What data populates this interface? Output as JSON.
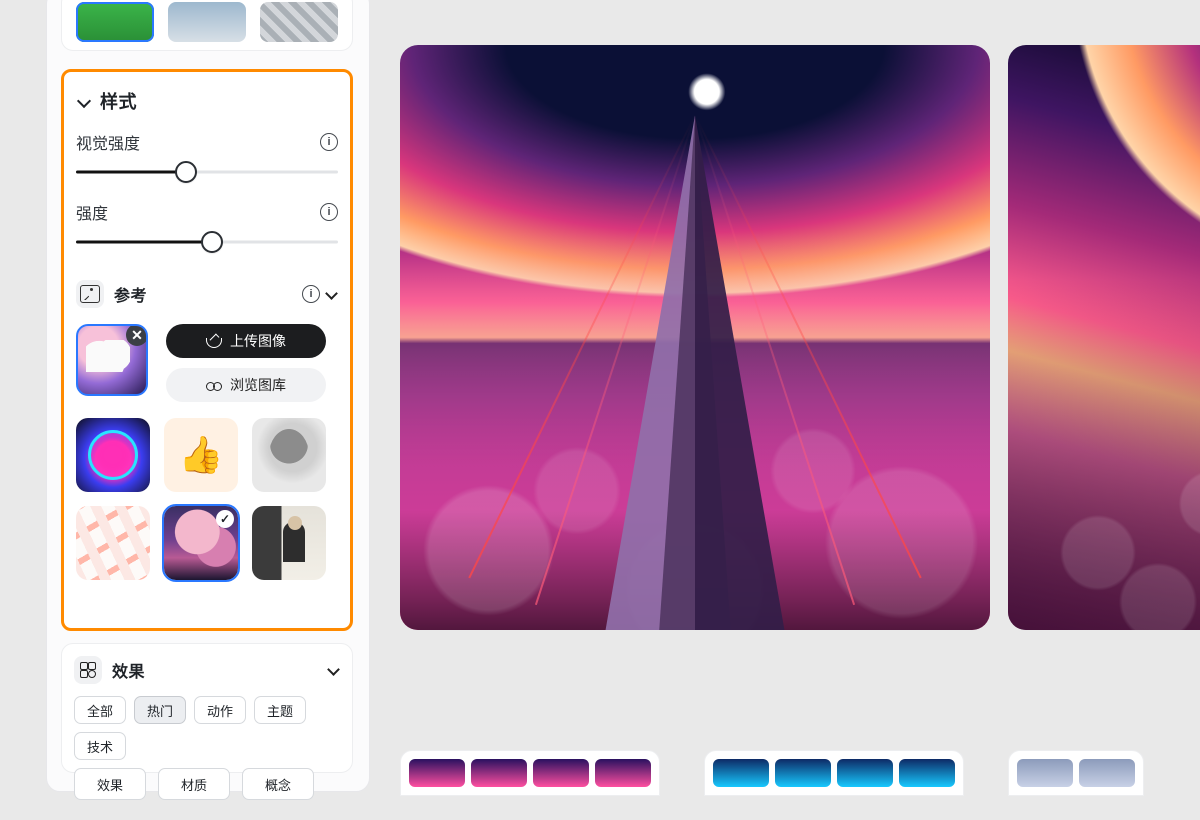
{
  "style_section": {
    "title": "样式",
    "slider1": {
      "label": "视觉强度",
      "percent": 42
    },
    "slider2": {
      "label": "强度",
      "percent": 52
    },
    "reference": {
      "title": "参考",
      "upload_btn": "上传图像",
      "browse_btn": "浏览图库"
    }
  },
  "effects_section": {
    "title": "效果",
    "tabs": [
      "全部",
      "热门",
      "动作",
      "主题",
      "技术"
    ],
    "active_tab_index": 1,
    "chips2": [
      "效果",
      "材质",
      "概念"
    ]
  },
  "icons": {
    "chevron_down": "chevron-down",
    "info": "i",
    "close": "✕",
    "check": "✓"
  }
}
